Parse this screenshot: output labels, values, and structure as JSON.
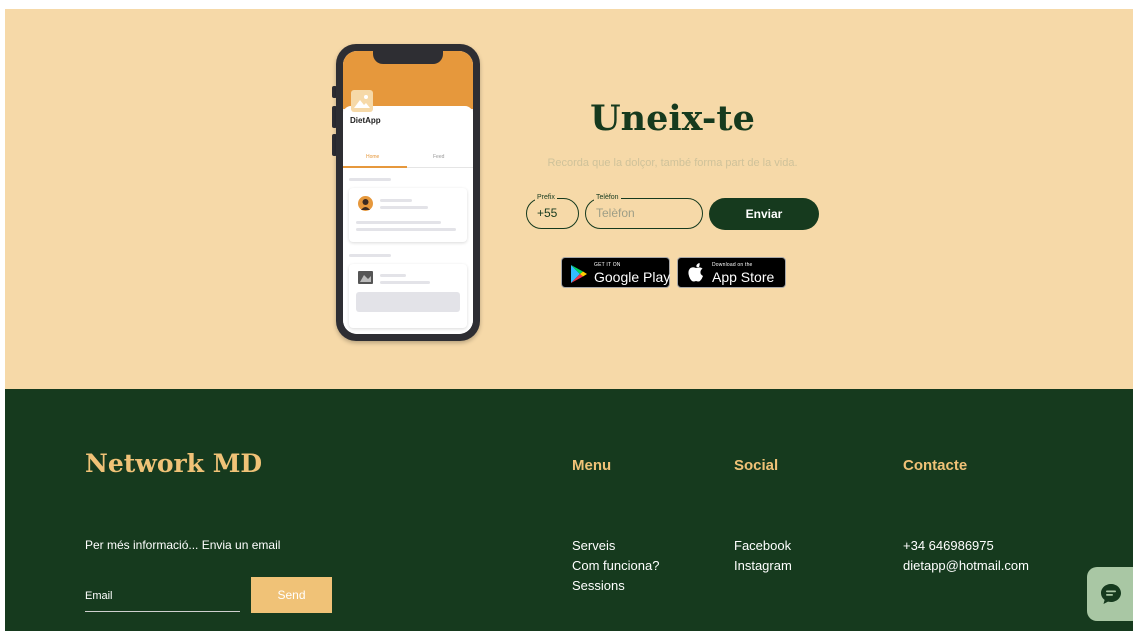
{
  "hero": {
    "title": "Uneix-te",
    "subtitle": "Recorda que la dolçor, també forma part de la vida.",
    "prefix_label": "Prefix",
    "prefix_value": "+55",
    "phone_label": "Telèfon",
    "phone_placeholder": "Telèfon",
    "submit_label": "Enviar",
    "google_play": {
      "small": "GET IT ON",
      "big": "Google Play"
    },
    "app_store": {
      "small": "Download on the",
      "big": "App Store"
    }
  },
  "phone_mockup": {
    "app_name": "DietApp",
    "tabs": [
      "Home",
      "Feed"
    ]
  },
  "footer": {
    "brand": "Network MD",
    "info_text": "Per més informació... Envia un email",
    "email_placeholder": "Email",
    "send_label": "Send",
    "menu": {
      "heading": "Menu",
      "items": [
        "Serveis",
        "Com funciona?",
        "Sessions"
      ]
    },
    "social": {
      "heading": "Social",
      "items": [
        "Facebook",
        "Instagram"
      ]
    },
    "contact": {
      "heading": "Contacte",
      "items": [
        "+34 646986975",
        "dietapp@hotmail.com"
      ]
    }
  },
  "chat": {
    "icon": "chat-icon"
  },
  "colors": {
    "hero_bg": "#f6d9a8",
    "footer_bg": "#163a1e",
    "accent_gold": "#f0c277",
    "app_orange": "#e6983c"
  }
}
